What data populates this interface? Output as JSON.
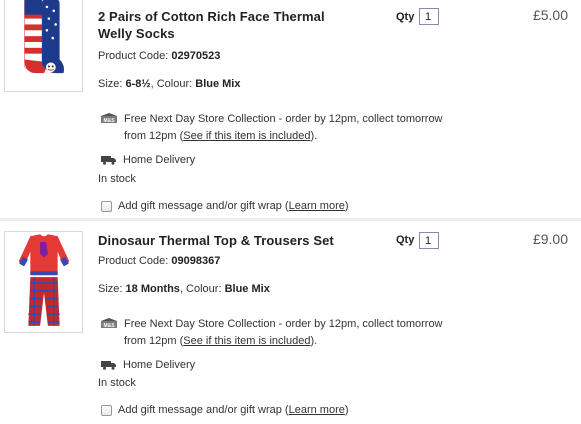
{
  "items": [
    {
      "title_line1": "2 Pairs of Cotton Rich Face Thermal",
      "title_line2": "Welly Socks",
      "qty_label": "Qty",
      "qty_value": "1",
      "price": "£5.00",
      "code_label": "Product Code:",
      "code_value": "02970523",
      "size_label": "Size:",
      "size_value": "6-8½",
      "colour_label": ", Colour:",
      "colour_value": "Blue Mix",
      "store_icon": "store-collection-icon",
      "collection_line1": "Free Next Day Store Collection - order by 12pm, collect tomorrow",
      "collection_line2_prefix": "from 12pm (",
      "collection_link": "See if this item is included",
      "collection_line2_suffix": ").",
      "delivery_icon": "truck-icon",
      "home_delivery": "Home Delivery",
      "stock": "In stock",
      "gift_text": "Add gift message and/or gift wrap (",
      "gift_link": "Learn more",
      "gift_suffix": ")"
    },
    {
      "title_line1": "Dinosaur Thermal Top & Trousers Set",
      "qty_label": "Qty",
      "qty_value": "1",
      "price": "£9.00",
      "code_label": "Product Code:",
      "code_value": "09098367",
      "size_label": "Size:",
      "size_value": "18 Months",
      "colour_label": ", Colour:",
      "colour_value": "Blue Mix",
      "store_icon": "store-collection-icon",
      "collection_line1": "Free Next Day Store Collection - order by 12pm, collect tomorrow",
      "collection_line2_prefix": "from 12pm (",
      "collection_link": "See if this item is included",
      "collection_line2_suffix": ").",
      "delivery_icon": "truck-icon",
      "home_delivery": "Home Delivery",
      "stock": "In stock",
      "gift_text": "Add gift message and/or gift wrap (",
      "gift_link": "Learn more",
      "gift_suffix": ")"
    }
  ],
  "colors": {
    "text": "#333333",
    "title": "#222222",
    "price": "#555555",
    "separator": "#ececec",
    "qty_border": "#8a8aa8"
  }
}
